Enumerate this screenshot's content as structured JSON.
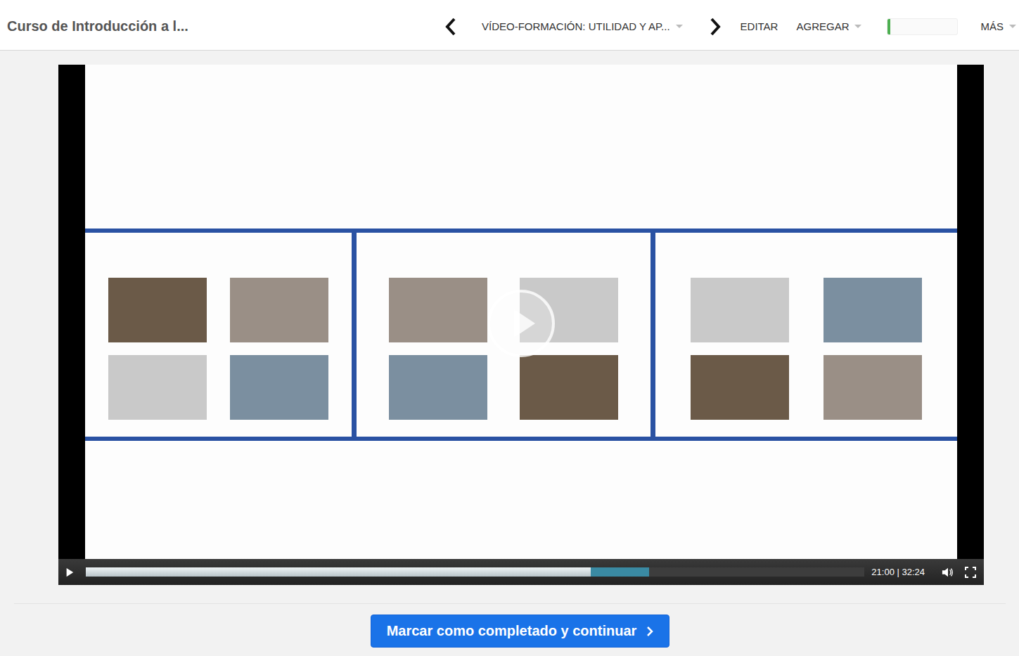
{
  "header": {
    "course_title": "Curso de Introducción a l...",
    "lesson": {
      "title": "VÍDEO-FORMACIÓN: UTILIDAD Y AP...",
      "dropdown": true
    },
    "actions": [
      {
        "label": "EDITAR",
        "dropdown": false
      },
      {
        "label": "AGREGAR",
        "dropdown": true
      }
    ],
    "progress": {
      "level": 0.04
    },
    "more": {
      "label": "MÁS",
      "dropdown": true
    }
  },
  "player": {
    "playing": false,
    "time": "21:00 | 32:24",
    "level": 0.648,
    "buffered": 0.723
  },
  "complete_button": {
    "label": "Marcar como completado y continuar"
  }
}
